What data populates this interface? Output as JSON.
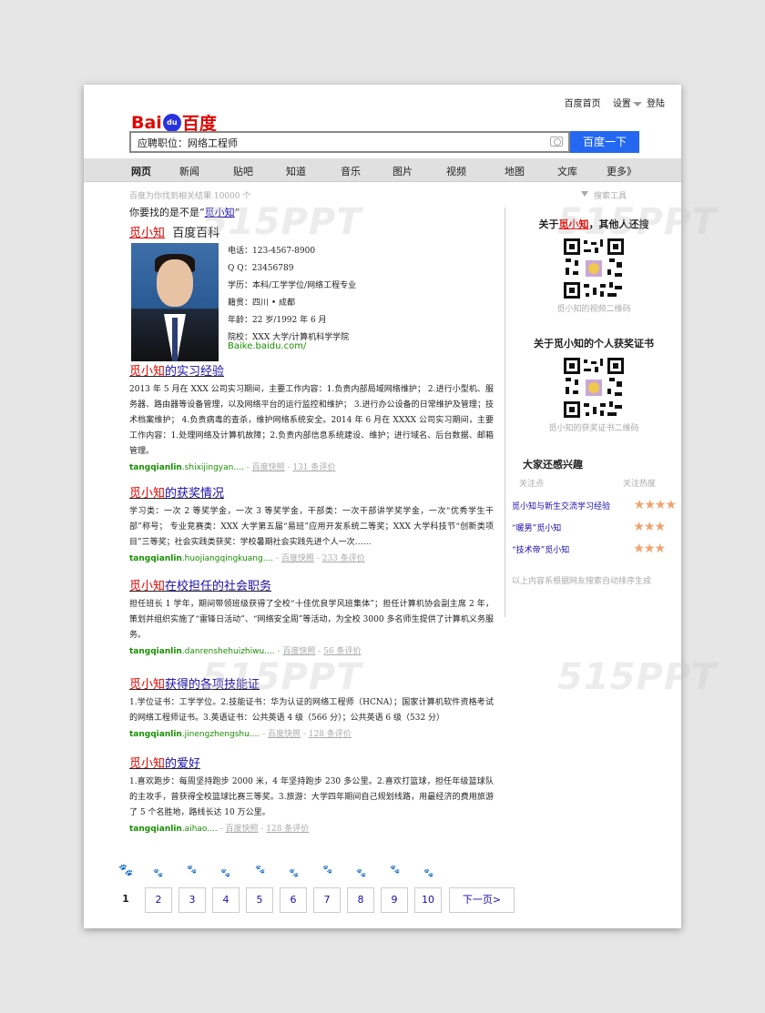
{
  "top_links": {
    "home": "百度首页",
    "settings": "设置",
    "login": "登陆"
  },
  "logo": {
    "bai": "Bai",
    "du": "du",
    "baidu": "百度"
  },
  "search": {
    "value": "应聘职位：网络工程师",
    "button": "百度一下"
  },
  "nav": [
    "网页",
    "新闻",
    "贴吧",
    "知道",
    "音乐",
    "图片",
    "视频",
    "地图",
    "文库",
    "更多》"
  ],
  "result_info": "百度为你找到相关结果 10000 个",
  "search_tools": "搜索工具",
  "did_you_mean": {
    "prefix": "你要找的是不是“",
    "name": "觅小知",
    "suffix": "”"
  },
  "baike": {
    "name": "觅小知",
    "source": "百度百科",
    "info": [
      "电话：123-4567-8900",
      "Q  Q：23456789",
      "学历：本科/工学学位/网络工程专业",
      "籍贯：四川 • 成都",
      "年龄：22 岁/1992 年 6 月",
      "院校：XXX 大学/计算机科学学院"
    ],
    "url": "Baike.baidu.com/"
  },
  "sections": [
    {
      "name": "觅小知",
      "title": "的实习经验",
      "body": "2013 年 5 月在 XXX 公司实习期间，主要工作内容：1.负责内部局域网络维护； 2.进行小型机、服务器、路由器等设备管理，以及网络平台的运行监控和维护； 3.进行办公设备的日常维护及管理；技术档案维护； 4.负责病毒的查杀，维护网络系统安全。2014 年 6 月在 XXXX 公司实习期间，主要工作内容：1.处理网络及计算机故障；2.负责内部信息系统建设、维护；进行域名、后台数据、邮箱管理。",
      "url_bold": "tangqianlin",
      "url_rest": ".shixijingyan....",
      "snapshot": "百度快照",
      "reviews": "131 条评价"
    },
    {
      "name": "觅小知",
      "title": "的获奖情况",
      "body": "学习类：一次 2 等奖学金，一次 3 等奖学金，干部类：一次干部讲学奖学金，一次“优秀学生干部”称号； 专业竞赛类：XXX 大学第五届“易班”应用开发系统二等奖；XXX 大学科技节“创新类项目”三等奖；社会实践类获奖：学校暑期社会实践先进个人一次……",
      "url_bold": "tangqianlin",
      "url_rest": ".huojiangqingkuang....",
      "snapshot": "百度快照",
      "reviews": "233 条评价"
    },
    {
      "name": "觅小知",
      "title": "在校担任的社会职务",
      "body": "担任班长 1 学年，期间带领班级获得了全校“十佳优良学风班集体”；担任计算机协会副主席 2 年，策划并组织实施了“雷锋日活动”、“网络安全周”等活动，为全校 3000 多名师生提供了计算机义务服务。",
      "url_bold": "tangqianlin",
      "url_rest": ".danrenshehuizhiwu....",
      "snapshot": "百度快照",
      "reviews": "56 条评价"
    },
    {
      "name": "觅小知",
      "title": "获得的各项技能证",
      "body": "1.学位证书：工学学位。2.技能证书：华为认证的网络工程师（HCNA）；国家计算机软件资格考试的网络工程师证书。3.英语证书：公共英语 4 级（566 分）；公共英语 6 级（532 分）",
      "url_bold": "tangqianlin",
      "url_rest": ".jinengzhengshu....",
      "snapshot": "百度快照",
      "reviews": "128 条评价"
    },
    {
      "name": "觅小知",
      "title": "的爱好",
      "body": "1.喜欢跑步：每周坚持跑步 2000 米，4 年坚持跑步 230 多公里。2.喜欢打篮球，担任年级篮球队的主攻手，曾获得全校篮球比赛三等奖。3.旅游：大学四年期间自己规划线路，用最经济的费用旅游了 5 个名胜地，路线长达 10 万公里。",
      "url_bold": "tangqianlin",
      "url_rest": ".aihao....",
      "snapshot": "百度快照",
      "reviews": "128 条评价"
    }
  ],
  "sidebar": {
    "box1": {
      "prefix": "关于",
      "name": "觅小知",
      "suffix": "，其他人还搜",
      "caption": "觅小知的视频二维码"
    },
    "box2": {
      "title": "关于觅小知的个人获奖证书",
      "caption": "觅小知的获奖证书二维码"
    },
    "interest": {
      "title": "大家还感兴趣",
      "col1": "关注点",
      "col2": "关注热度",
      "rows": [
        {
          "label": "觅小知与新生交流学习经验",
          "stars": "★★★★"
        },
        {
          "label": "“暖男”觅小知",
          "stars": "★★★"
        },
        {
          "label": "“技术帝”觅小知",
          "stars": "★★★"
        }
      ]
    },
    "footnote": "以上内容系根据网友搜索自动排序生成"
  },
  "pagination": {
    "pages": [
      "1",
      "2",
      "3",
      "4",
      "5",
      "6",
      "7",
      "8",
      "9",
      "10"
    ],
    "next": "下一页>",
    "current": "1"
  },
  "watermark": "515PPT"
}
